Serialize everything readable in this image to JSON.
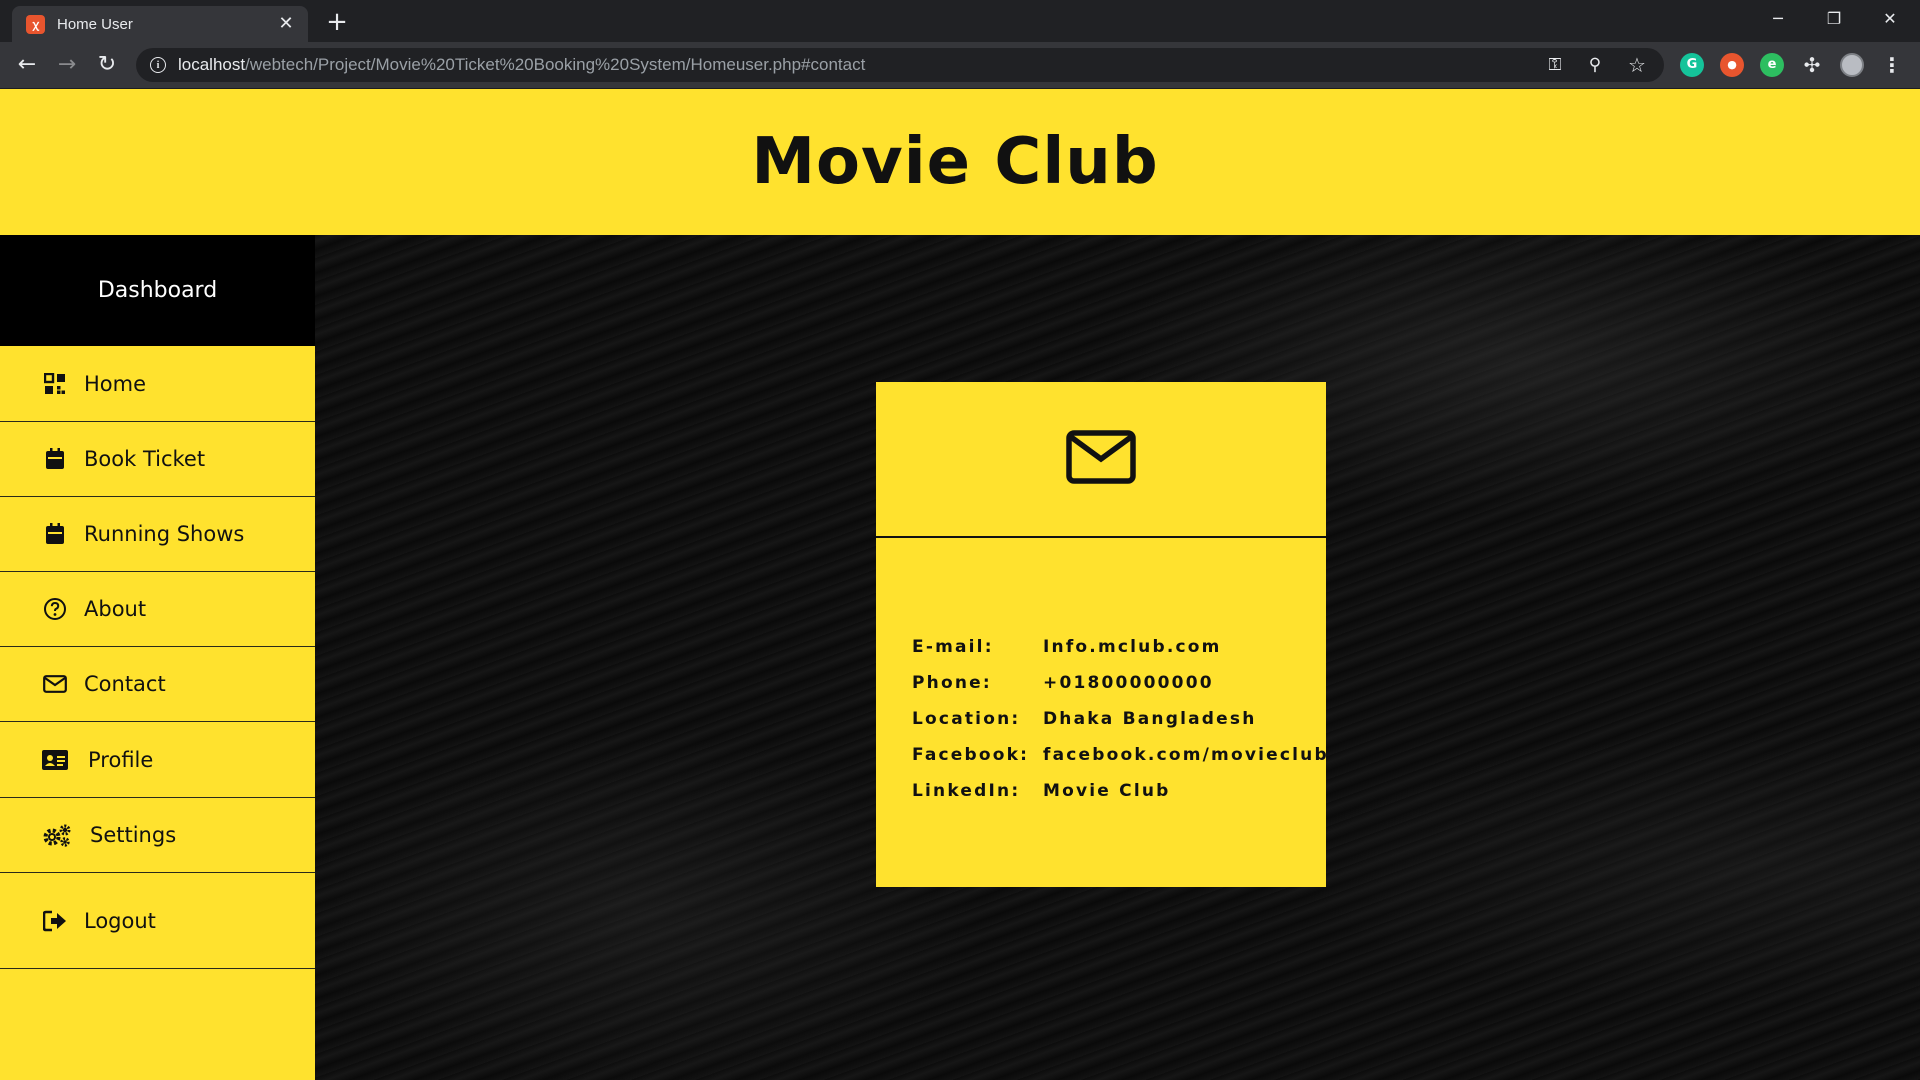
{
  "browser": {
    "tab_title": "Home User",
    "tab_favicon": "xampp-icon",
    "url_host": "localhost",
    "url_path": "/webtech/Project/Movie%20Ticket%20Booking%20System/Homeuser.php#contact"
  },
  "site": {
    "title": "Movie Club",
    "accent_color": "#ffe22e"
  },
  "sidebar": {
    "heading": "Dashboard",
    "items": [
      {
        "label": "Home",
        "icon": "grid-icon"
      },
      {
        "label": "Book Ticket",
        "icon": "calendar-icon"
      },
      {
        "label": "Running Shows",
        "icon": "calendar-icon"
      },
      {
        "label": "About",
        "icon": "question-circle-icon"
      },
      {
        "label": "Contact",
        "icon": "envelope-icon"
      },
      {
        "label": "Profile",
        "icon": "id-card-icon"
      },
      {
        "label": "Settings",
        "icon": "gears-icon"
      },
      {
        "label": "Logout",
        "icon": "sign-out-icon"
      }
    ]
  },
  "contact": {
    "icon": "envelope-icon",
    "rows": [
      {
        "label": "E-mail:",
        "value": "Info.mclub.com"
      },
      {
        "label": "Phone:",
        "value": "+01800000000"
      },
      {
        "label": "Location:",
        "value": "Dhaka Bangladesh"
      },
      {
        "label": "Facebook:",
        "value": "facebook.com/movieclub"
      },
      {
        "label": "LinkedIn:",
        "value": "Movie Club"
      }
    ]
  }
}
